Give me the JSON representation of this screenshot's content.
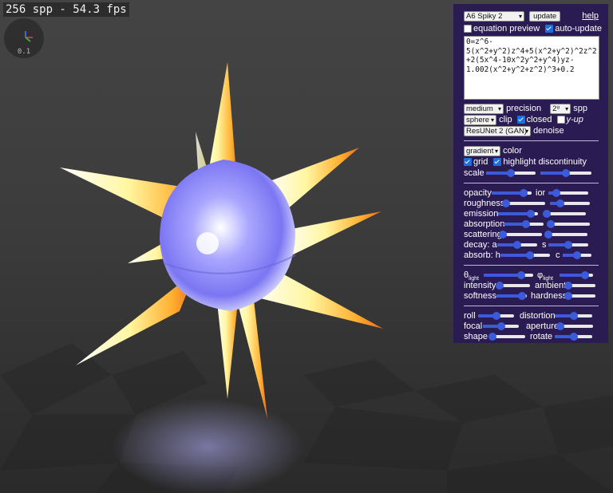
{
  "status": {
    "fps_text": "256 spp - 54.3 fps",
    "axis_scale": "0.1"
  },
  "icons": {
    "axis_widget": "xyz-axis-gizmo-icon"
  },
  "panel": {
    "preset_select": "A6 Spiky 2",
    "update_button": "update",
    "help_link": "help",
    "equation_preview_label": "equation preview",
    "equation_preview_checked": false,
    "auto_update_label": "auto-update",
    "auto_update_checked": true,
    "equation": "0=z^6-5(x^2+y^2)z^4+5(x^2+y^2)^2z^2+2(5x^4-10x^2y^2+y^4)yz-1.002(x^2+y^2+z^2)^3+0.2",
    "precision_select": "medium",
    "precision_label": "precision",
    "spp_select": "2⁸",
    "spp_label": "spp",
    "clip_select": "sphere",
    "clip_label": "clip",
    "closed_label": "closed",
    "closed_checked": true,
    "yup_label": "y-up",
    "yup_checked": false,
    "denoise_select": "ResUNet 2 (GAN)",
    "denoise_label": "denoise",
    "color_select": "gradient",
    "color_label": "color",
    "grid_label": "grid",
    "grid_checked": true,
    "highlight_label": "highlight discontinuity",
    "highlight_checked": true,
    "scale_label": "scale",
    "scale_values": [
      0.5,
      0.5
    ],
    "opacity_label": "opacity",
    "opacity_value": 0.8,
    "ior_label": "ior",
    "ior_value": 0.2,
    "roughness_label": "roughness",
    "roughness_value": 0.02,
    "roughness2_value": 0.25,
    "emission_label": "emission",
    "emission_value": 0.82,
    "emission2_value": 0.02,
    "absorption_label": "absorption",
    "absorption_value": 0.55,
    "absorption2_value": 0.02,
    "scattering_label": "scattering",
    "scattering_value": 0.02,
    "scattering2_value": 0.02,
    "decay_a_label": "decay: a",
    "decay_a_value": 0.5,
    "decay_s_label": "s",
    "decay_s_value": 0.5,
    "absorb_h_label": "absorb: h",
    "absorb_h_value": 0.6,
    "absorb_c_label": "c",
    "absorb_c_value": 0.5,
    "theta_label": "θ",
    "theta_sub": "light",
    "theta_value": 0.75,
    "phi_label": "φ",
    "phi_sub": "light",
    "phi_value": 0.75,
    "intensity_label": "intensity",
    "intensity_value": 0.05,
    "ambient_label": "ambient",
    "ambient_value": 0.02,
    "softness_label": "softness",
    "softness_value": 0.85,
    "hardness_label": "hardness",
    "hardness_value": 0.02,
    "roll_label": "roll",
    "roll_value": 0.5,
    "distortion_label": "distortion",
    "distortion_value": 0.5,
    "focal_label": "focal",
    "focal_value": 0.5,
    "aperture_label": "aperture",
    "aperture_value": 0.02,
    "shape_label": "shape",
    "shape_value": 0.02,
    "rotate_label": "rotate",
    "rotate_value": 0.5
  },
  "colors": {
    "panel_bg": "#2a1c52",
    "slider_accent": "#3b5bdb"
  }
}
